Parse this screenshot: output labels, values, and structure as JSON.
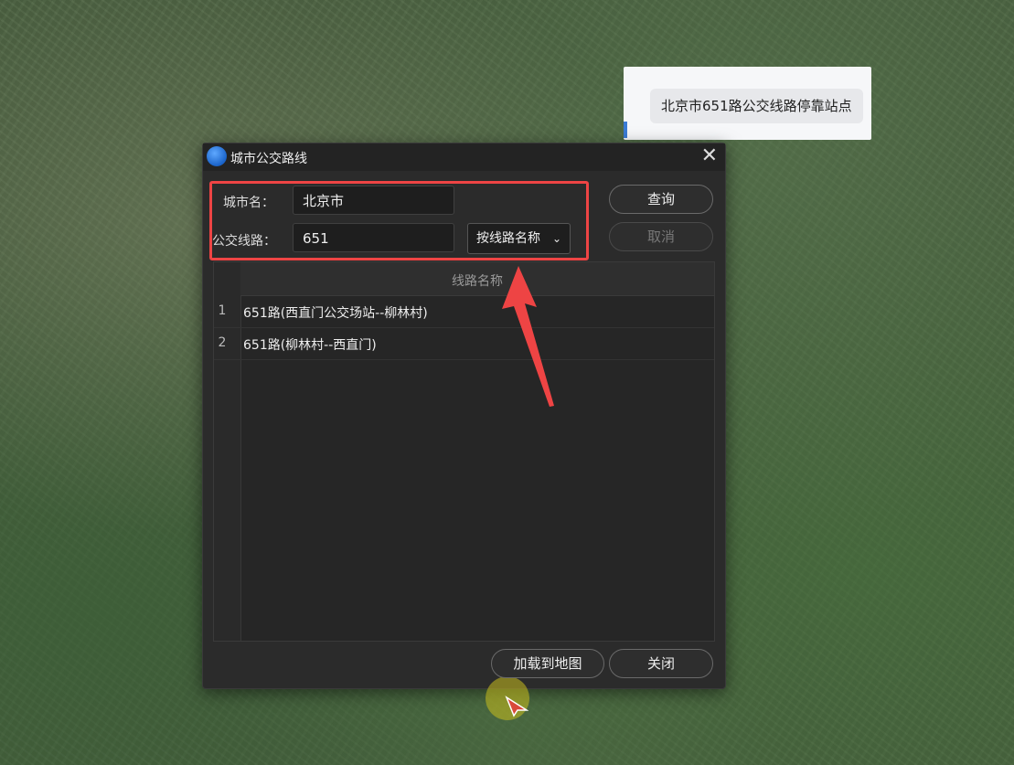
{
  "popup": {
    "label": "北京市651路公交线路停靠站点"
  },
  "dialog": {
    "title": "城市公交路线",
    "city_label": "城市名：",
    "city_value": "北京市",
    "route_label": "公交线路：",
    "route_value": "651",
    "search_mode": "按线路名称",
    "query_button": "查询",
    "cancel_button": "取消",
    "table": {
      "header": "线路名称",
      "rows": [
        {
          "index": "1",
          "name": "651路(西直门公交场站--柳林村)"
        },
        {
          "index": "2",
          "name": "651路(柳林村--西直门)"
        }
      ]
    },
    "load_button": "加载到地图",
    "close_button": "关闭"
  },
  "colors": {
    "highlight": "#ee4444",
    "accent": "#1a63c9"
  },
  "icons": {
    "app": "globe-icon",
    "close": "close-icon",
    "dropdown": "chevron-down-icon"
  }
}
